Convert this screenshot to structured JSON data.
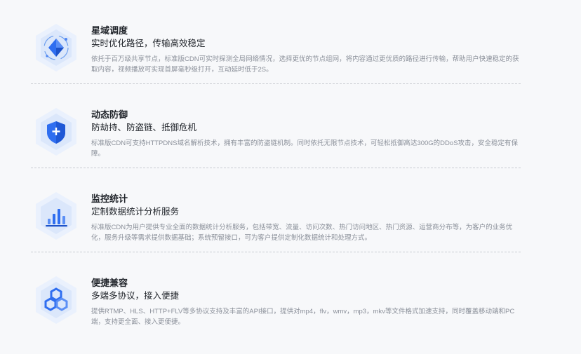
{
  "features": [
    {
      "icon": "star-domain-scheduling-icon",
      "title": "星域调度",
      "subtitle": "实时优化路径，传输高效稳定",
      "description": "依托于百万级共享节点，标准版CDN可实时探测全局网络情况，选择更优的节点组网，将内容通过更优质的路径进行传输，帮助用户快速稳定的获取内容，视频播放可实现首屏毫秒级打开，互动延时低于2S。"
    },
    {
      "icon": "shield-plus-icon",
      "title": "动态防御",
      "subtitle": "防劫持、防盗链、抵御危机",
      "description": "标准版CDN可支持HTTPDNS域名解析技术，拥有丰富的防盗链机制。同时依托无限节点技术，可轻松抵御高达300G的DDoS攻击，安全稳定有保障。"
    },
    {
      "icon": "bar-chart-icon",
      "title": "监控统计",
      "subtitle": "定制数据统计分析服务",
      "description": "标准版CDN为用户提供专业全面的数据统计分析服务，包括带宽、流量、访问次数、热门访问地区、热门资源、运营商分布等，为客户的业务优化，服务升级等需求提供数据基础；系统预留接口，可为客户提供定制化数据统计和处理方式。"
    },
    {
      "icon": "hexagon-cluster-icon",
      "title": "便捷兼容",
      "subtitle": "多端多协议，接入便捷",
      "description": "提供RTMP、HLS、HTTP+FLV等多协议支持及丰富的API接口，提供对mp4，flv，wmv，mp3，mkv等文件格式加速支持，同时覆盖移动端和PC端，支持更全面、接入更便捷。"
    }
  ]
}
